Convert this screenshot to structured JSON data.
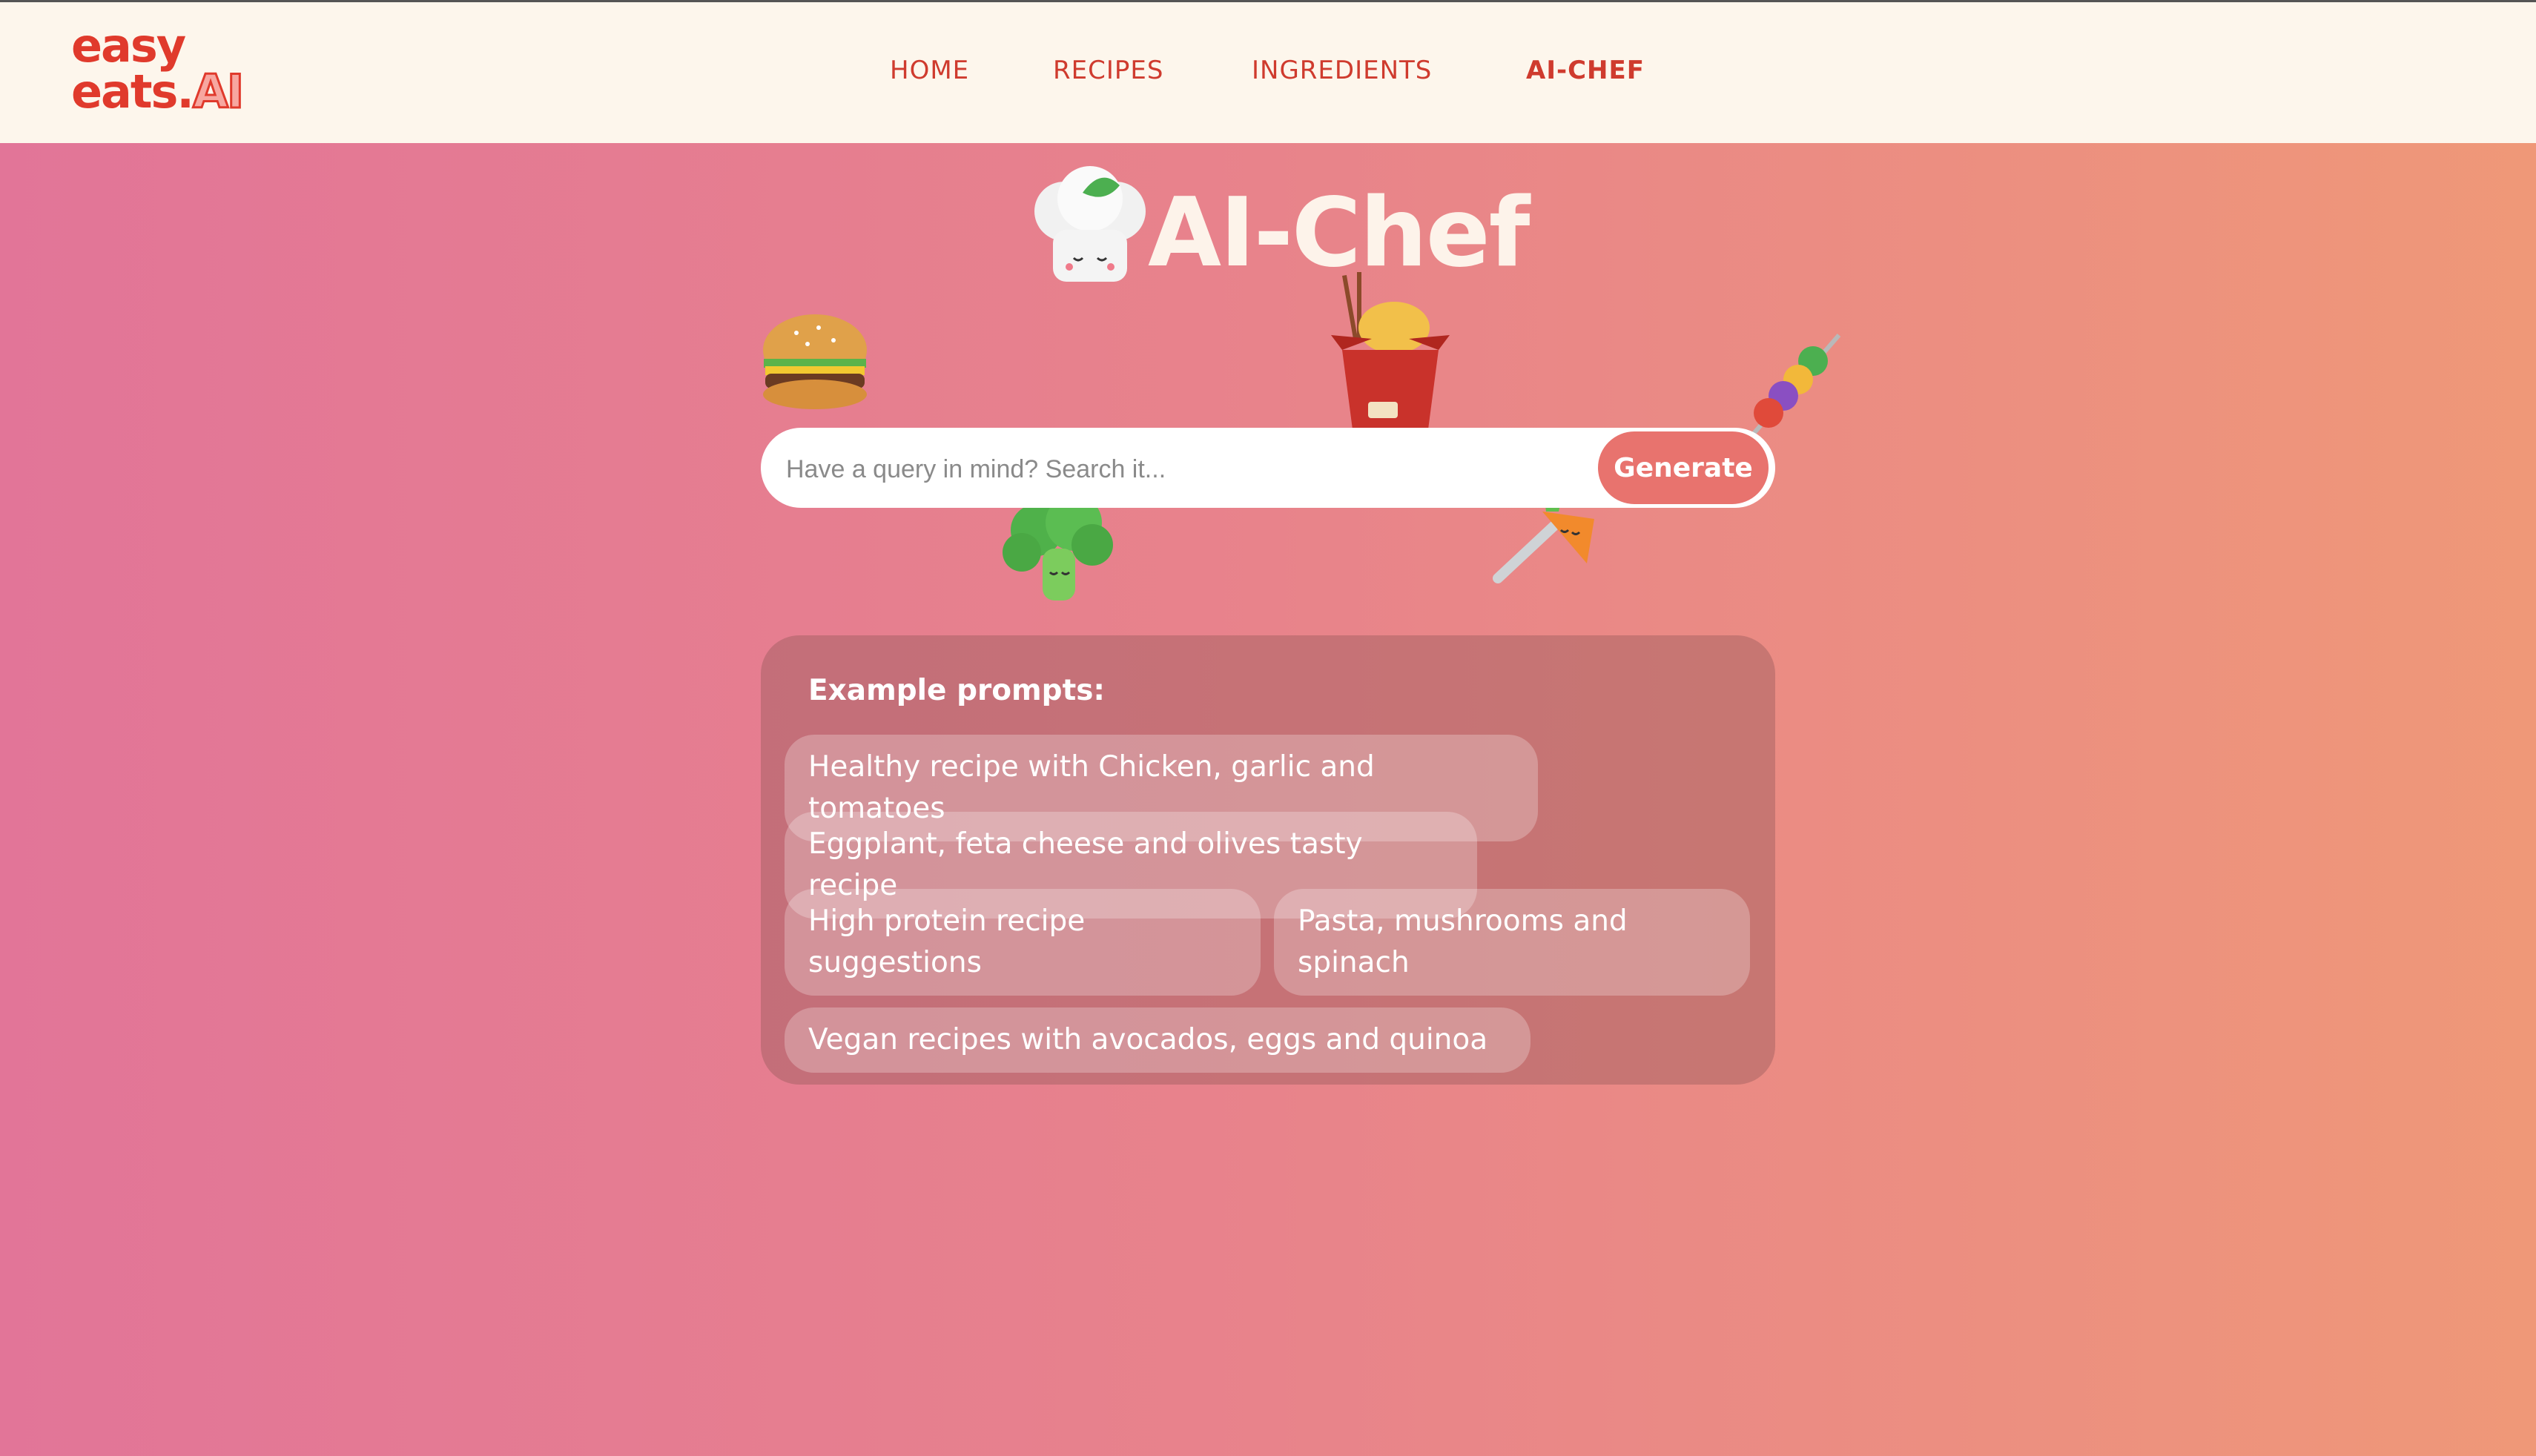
{
  "brand": {
    "line1": "easy",
    "line2_main": "eats.",
    "line2_accent": "AI"
  },
  "nav": {
    "home": "HOME",
    "recipes": "RECIPES",
    "ingredients": "INGREDIENTS",
    "ai_chef": "AI-CHEF",
    "active": "AI-CHEF"
  },
  "hero": {
    "title": "AI-Chef",
    "icon": "chef-hat-icon"
  },
  "stickers": [
    "burger-icon",
    "noodle-box-icon",
    "skewer-icon",
    "broccoli-icon",
    "carrot-fork-icon"
  ],
  "search": {
    "placeholder": "Have a query in mind? Search it...",
    "value": "",
    "button": "Generate"
  },
  "examples": {
    "title": "Example prompts:",
    "prompts": [
      "Healthy recipe with Chicken, garlic and tomatoes",
      "Eggplant, feta cheese and olives tasty recipe",
      "High protein recipe suggestions",
      "Pasta, mushrooms and spinach",
      "Vegan recipes with avocados, eggs and quinoa"
    ]
  },
  "colors": {
    "header_bg": "#fdf6ec",
    "nav_text": "#cf3b2e",
    "gradient_start": "#e27598",
    "gradient_end": "#ef9878",
    "button_bg": "#e8736e"
  }
}
